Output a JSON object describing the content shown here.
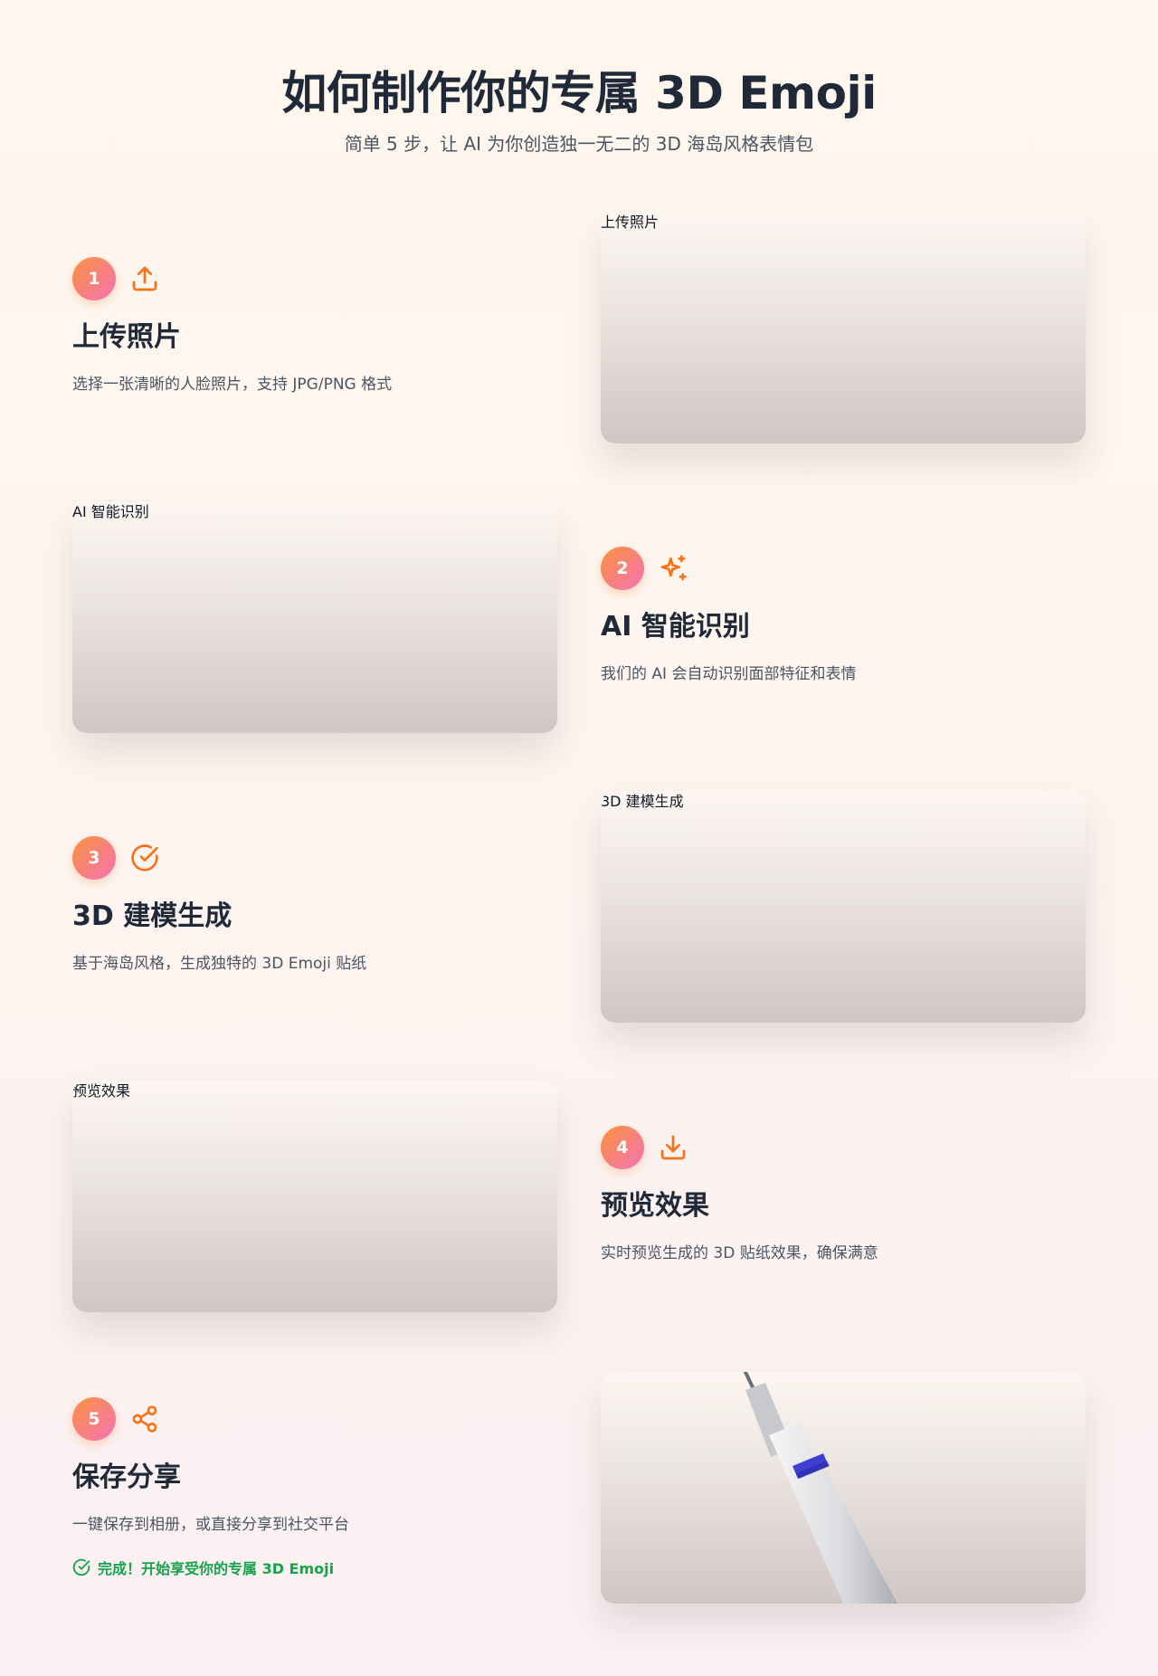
{
  "header": {
    "title": "如何制作你的专属 3D Emoji",
    "subtitle": "简单 5 步，让 AI 为你创造独一无二的 3D 海岛风格表情包"
  },
  "steps": [
    {
      "number": "1",
      "icon": "upload-icon",
      "title": "上传照片",
      "description": "选择一张清晰的人脸照片，支持 JPG/PNG 格式",
      "image_label": "上传照片"
    },
    {
      "number": "2",
      "icon": "sparkles-icon",
      "title": "AI 智能识别",
      "description": "我们的 AI 会自动识别面部特征和表情",
      "image_label": "AI 智能识别"
    },
    {
      "number": "3",
      "icon": "check-circle-icon",
      "title": "3D 建模生成",
      "description": "基于海岛风格，生成独特的 3D Emoji 贴纸",
      "image_label": "3D 建模生成"
    },
    {
      "number": "4",
      "icon": "download-icon",
      "title": "预览效果",
      "description": "实时预览生成的 3D 贴纸效果，确保满意",
      "image_label": "预览效果"
    },
    {
      "number": "5",
      "icon": "share-icon",
      "title": "保存分享",
      "description": "一键保存到相册，或直接分享到社交平台",
      "completion": "完成！开始享受你的专属 3D Emoji"
    }
  ],
  "colors": {
    "accent_orange": "#f97316",
    "badge_gradient_start": "#fb923c",
    "badge_gradient_end": "#f472b6",
    "success_green": "#16a34a",
    "heading": "#1f2937",
    "body_text": "#4b5563"
  }
}
